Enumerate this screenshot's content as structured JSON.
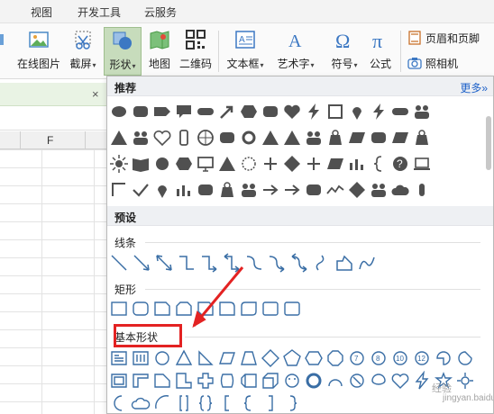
{
  "menu": {
    "tabs": [
      "视图",
      "开发工具",
      "云服务"
    ]
  },
  "ribbon": {
    "online_picture": "在线图片",
    "screenshot": "截屏",
    "shapes": "形状",
    "map": "地图",
    "qrcode": "二维码",
    "textbox": "文本框",
    "wordart": "艺术字",
    "symbol": "符号",
    "formula": "公式",
    "header_footer": "页眉和页脚",
    "camera": "照相机"
  },
  "sheet": {
    "column_label": "F",
    "close_symbol": "×"
  },
  "panel": {
    "recommended_title": "推荐",
    "more_label": "更多»",
    "preset_title": "预设",
    "lines_title": "线条",
    "rect_title": "矩形",
    "basic_title": "基本形状"
  },
  "watermark": {
    "main": "经验",
    "sub": "jingyan.baidu.com"
  },
  "colors": {
    "accent_active": "#c7dcbc",
    "highlight": "#e32222",
    "shape_fill": "#505050",
    "outline": "#3a6ea5"
  }
}
